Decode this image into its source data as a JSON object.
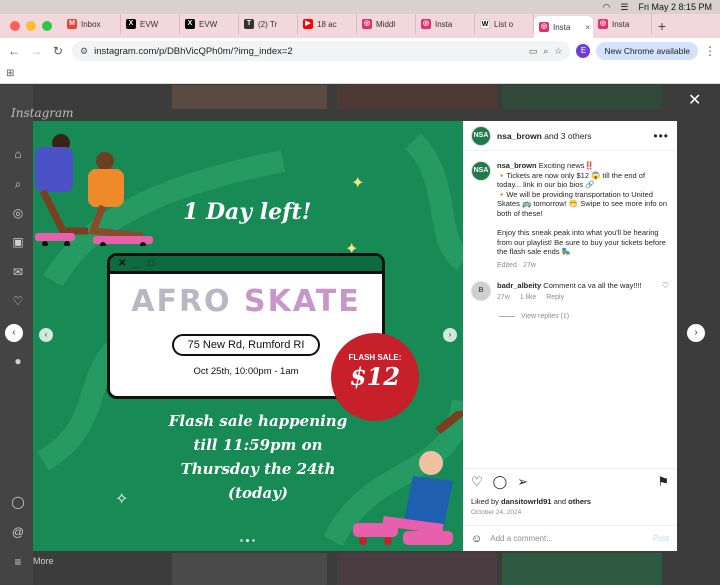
{
  "menubar": {
    "datetime": "Fri May 2  8:15 PM"
  },
  "tabs": [
    {
      "label": "Inbox",
      "favicon_color": "#ea4335",
      "favicon": "M"
    },
    {
      "label": "EVW",
      "favicon_color": "#000000",
      "favicon": "X"
    },
    {
      "label": "EVW",
      "favicon_color": "#000000",
      "favicon": "X"
    },
    {
      "label": "(2) Tr",
      "favicon_color": "#333333",
      "favicon": "T"
    },
    {
      "label": "18 ac",
      "favicon_color": "#ff0000",
      "favicon": "▶"
    },
    {
      "label": "Middl",
      "favicon_color": "#e1306c",
      "favicon": "◎"
    },
    {
      "label": "Insta",
      "favicon_color": "#e1306c",
      "favicon": "◎"
    },
    {
      "label": "List o",
      "favicon_color": "#ffffff",
      "favicon": "W"
    },
    {
      "label": "Insta",
      "favicon_color": "#e1306c",
      "favicon": "◎",
      "active": true
    },
    {
      "label": "Insta",
      "favicon_color": "#e1306c",
      "favicon": "◎"
    }
  ],
  "toolbar": {
    "url": "instagram.com/p/DBhVicQPh0m/?img_index=2",
    "profile_initial": "E",
    "new_chrome_label": "New Chrome available"
  },
  "instagram": {
    "logo": "Instagram",
    "more_label": "More"
  },
  "post": {
    "header": {
      "author": "nsa_brown",
      "others": "and 3 others"
    },
    "caption": {
      "author": "nsa_brown",
      "lines": [
        "Exciting news‼️",
        "🔸Tickets are now only $12 😱 till the end of today... link in our bio bios 🔗",
        "🔸We will be providing transportation to United Skates 🚌 tomorrow! 😁 Swipe to see more info on both of these!",
        "",
        "Enjoy this sneak peak into what you'll be hearing from our playlist! Be sure to buy your tickets before the flash sale ends 🛼"
      ],
      "meta": "Edited · 27w"
    },
    "comment": {
      "author": "badr_albeity",
      "text": "Comment ca va all the way!!!!",
      "age": "27w",
      "likes": "1 like",
      "reply": "Reply"
    },
    "view_replies": "View replies (1)",
    "liked_by_prefix": "Liked by",
    "liked_by_user": "dansitowrld91",
    "liked_by_and": "and",
    "liked_by_others": "others",
    "date": "October 24, 2024",
    "add_comment_placeholder": "Add a comment...",
    "post_label": "Post"
  },
  "poster": {
    "title": "1 Day left!",
    "brand_a": "AFRO",
    "brand_b": "SKATE",
    "address": "75 New Rd, Rumford RI",
    "datetime": "Oct 25th, 10:00pm - 1am",
    "flash_label": "FLASH SALE:",
    "flash_price": "$12",
    "bottom": "Flash sale happening till 11:59pm on Thursday the 24th (today)"
  }
}
